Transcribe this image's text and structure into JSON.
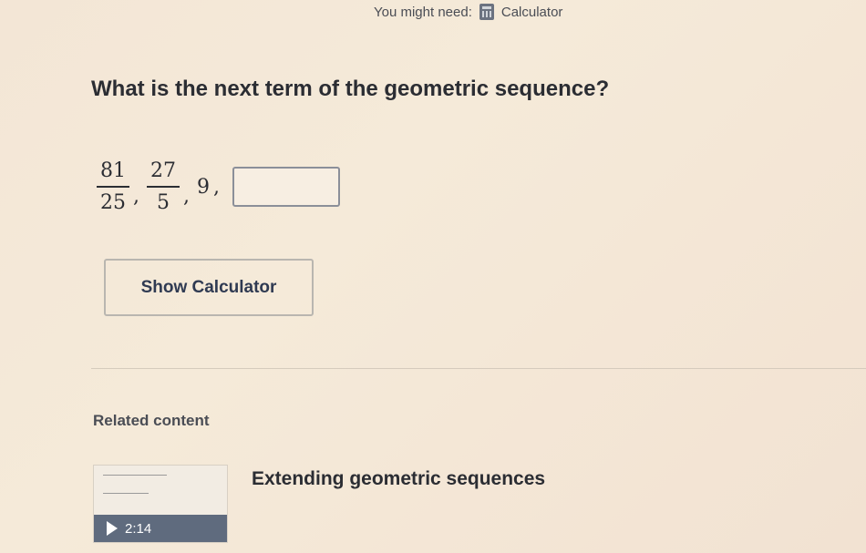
{
  "toolbar": {
    "you_might_need": "You might need:",
    "calculator_label": "Calculator"
  },
  "question": {
    "prompt": "What is the next term of the geometric sequence?",
    "terms": [
      {
        "numerator": "81",
        "denominator": "25"
      },
      {
        "numerator": "27",
        "denominator": "5"
      },
      {
        "value": "9"
      }
    ],
    "separator": ",",
    "answer_value": ""
  },
  "buttons": {
    "show_calculator": "Show Calculator"
  },
  "related": {
    "heading": "Related content",
    "items": [
      {
        "title": "Extending geometric sequences",
        "duration": "2:14",
        "icon": "play-icon"
      }
    ]
  }
}
